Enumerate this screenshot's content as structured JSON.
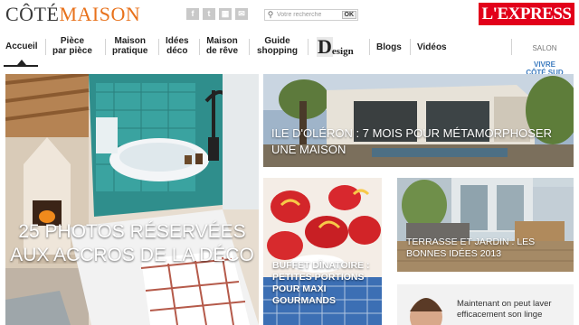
{
  "header": {
    "logo": {
      "part1": "CÔTÉ",
      "part2": "MAISON"
    },
    "social_icons": [
      {
        "name": "facebook-icon",
        "glyph": "f"
      },
      {
        "name": "twitter-icon",
        "glyph": "t"
      },
      {
        "name": "rss-icon",
        "glyph": "▦"
      },
      {
        "name": "mail-icon",
        "glyph": "✉"
      }
    ],
    "search": {
      "placeholder": "Votre recherche",
      "button_label": "OK"
    },
    "partner": "L'EXPRESS"
  },
  "nav": {
    "items": [
      {
        "id": "accueil",
        "label": "Accueil"
      },
      {
        "id": "piece",
        "label": "Pièce\npar pièce"
      },
      {
        "id": "maison-pratique",
        "label": "Maison\npratique"
      },
      {
        "id": "idees-deco",
        "label": "Idées\ndéco"
      },
      {
        "id": "maison-reve",
        "label": "Maison\nde rêve"
      },
      {
        "id": "guide-shopping",
        "label": "Guide\nshopping"
      },
      {
        "id": "blogs",
        "label": "Blogs"
      },
      {
        "id": "videos",
        "label": "Vidéos"
      }
    ],
    "design": {
      "initial": "D",
      "rest": "esign"
    },
    "salon": {
      "line1": "SALON",
      "line2": "VIVRE\nCÔTÉ SUD"
    },
    "active": "Accueil"
  },
  "tiles": [
    {
      "id": "photos-reservees",
      "caption": "25 PHOTOS RÉSERVÉES AUX ACCROS DE LA DÉCO"
    },
    {
      "id": "ile-oleron",
      "caption": "ILE D'OLÉRON : 7 MOIS POUR MÉTAMORPHOSER UNE MAISON"
    },
    {
      "id": "buffet-dinatoire",
      "caption": "BUFFET DÎNATOIRE : PETITES PORTIONS POUR MAXI GOURMANDS"
    },
    {
      "id": "terrasse-jardin",
      "caption": "TERRASSE ET JARDIN : LES BONNES IDÉES 2013"
    },
    {
      "id": "promo-linge",
      "text": "Maintenant on peut laver efficacement son linge"
    }
  ],
  "colors": {
    "brand_orange": "#e8721c",
    "express_red": "#e2001a",
    "salon_blue": "#3c7bbf"
  }
}
